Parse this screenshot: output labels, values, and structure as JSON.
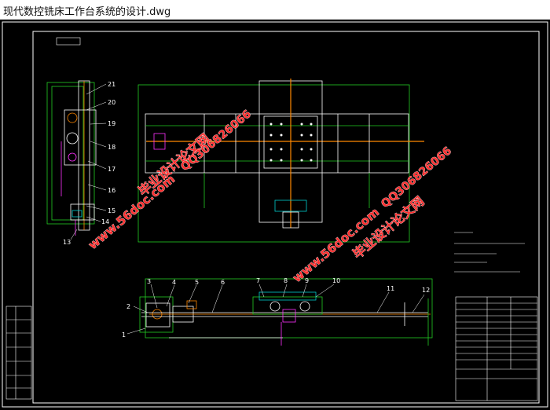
{
  "window": {
    "title": "现代数控铣床工作台系统的设计.dwg"
  },
  "drawing": {
    "part_numbers": [
      "21",
      "20",
      "19",
      "18",
      "17",
      "16",
      "15",
      "14",
      "13",
      "1",
      "2",
      "3",
      "4",
      "5",
      "6",
      "7",
      "8",
      "9",
      "10",
      "11",
      "12"
    ],
    "watermarks": {
      "site": "www.56doc.com",
      "brand": "毕业设计论文网",
      "qq": "QQ306826066"
    },
    "colors": {
      "background": "#000000",
      "frame": "#ffffff",
      "green": "#22cc22",
      "cyan": "#00cccc",
      "orange": "#ff8800",
      "magenta": "#ff33ff",
      "watermark_red": "#ff3030"
    }
  }
}
